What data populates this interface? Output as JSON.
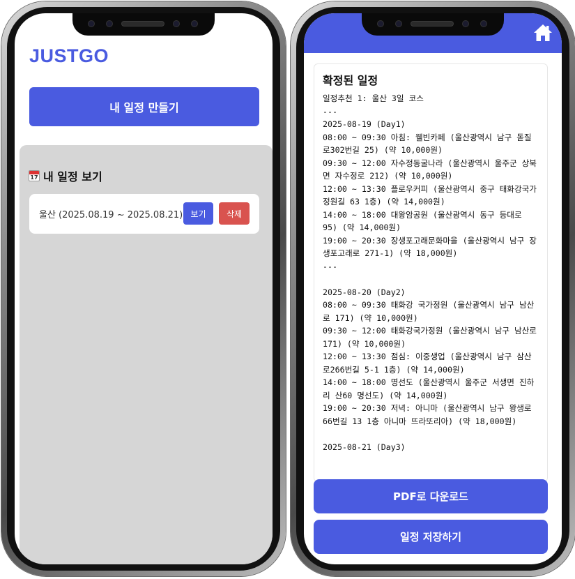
{
  "left_screen": {
    "logo": "JUSTGO",
    "create_button": "내 일정 만들기",
    "section_title": "내 일정 보기",
    "calendar_icon_day": "17",
    "trip": {
      "label": "울산 (2025.08.19 ~ 2025.08.21)",
      "view_button": "보기",
      "delete_button": "삭제"
    }
  },
  "right_screen": {
    "card_title": "확정된 일정",
    "schedule_text": "일정추천 1: 울산 3일 코스\n---\n2025-08-19 (Day1)\n08:00 ~ 09:30 아침: 웰빈카페 (울산광역시 남구 돋질로302번길 25) (약 10,000원)\n09:30 ~ 12:00 자수정동굴나라 (울산광역시 울주군 상북면 자수정로 212) (약 10,000원)\n12:00 ~ 13:30 플로우커피 (울산광역시 중구 태화강국가정원길 63 1층) (약 14,000원)\n14:00 ~ 18:00 대왕암공원 (울산광역시 동구 등대로 95) (약 14,000원)\n19:00 ~ 20:30 장생포고래문화마을 (울산광역시 남구 장생포고래로 271-1) (약 18,000원)\n---\n\n2025-08-20 (Day2)\n08:00 ~ 09:30 태화강 국가정원 (울산광역시 남구 남산로 171) (약 10,000원)\n09:30 ~ 12:00 태화강국가정원 (울산광역시 남구 남산로 171) (약 10,000원)\n12:00 ~ 13:30 점심: 이중생업 (울산광역시 남구 삼산로266번길 5-1 1층) (약 14,000원)\n14:00 ~ 18:00 명선도 (울산광역시 울주군 서생면 진하리 산60 명선도) (약 14,000원)\n19:00 ~ 20:30 저녁: 아니마 (울산광역시 남구 왕생로66번길 13 1층 아니마 뜨라또리아) (약 18,000원)\n\n2025-08-21 (Day3)",
    "pdf_button": "PDF로 다운로드",
    "save_button": "일정 저장하기"
  },
  "colors": {
    "accent": "#4a5be0",
    "danger": "#d9534f",
    "panel_gray": "#d6d6d6"
  },
  "icons": {
    "home": "home-icon",
    "calendar": "calendar-icon"
  }
}
